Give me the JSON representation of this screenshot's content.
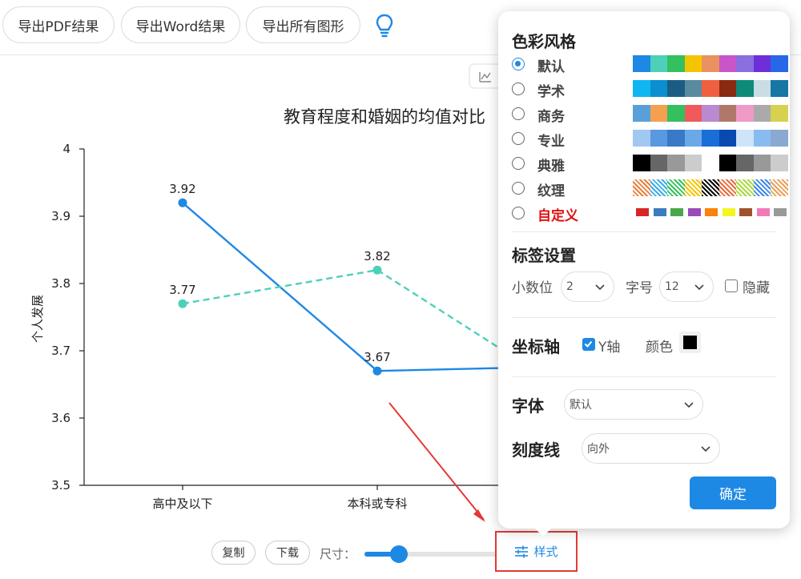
{
  "toolbar": {
    "export_pdf": "导出PDF结果",
    "export_word": "导出Word结果",
    "export_figures": "导出所有图形",
    "bulb_icon": "lightbulb-icon"
  },
  "chart_data": {
    "type": "line",
    "title": "教育程度和婚姻的均值对比",
    "ylabel": "个人发展",
    "xlabel": "",
    "ylim": [
      3.5,
      4
    ],
    "yticks": [
      3.5,
      3.6,
      3.7,
      3.8,
      3.9,
      4
    ],
    "categories": [
      "高中及以下",
      "本科或专科"
    ],
    "series": [
      {
        "values": [
          3.92,
          3.67
        ],
        "color": "#1e88e5",
        "dash": false,
        "extends": true,
        "label_values": [
          "3.92",
          "3.67"
        ]
      },
      {
        "values": [
          3.77,
          3.82
        ],
        "color": "#4dd0b9",
        "dash": true,
        "extends": true,
        "label_values": [
          "3.77",
          "3.82"
        ]
      }
    ],
    "grid": false
  },
  "chart_controls": {
    "copy": "复制",
    "download": "下载",
    "size_label": "尺寸：",
    "size_value": 0.25,
    "style": "样式",
    "style_icon": "sliders-icon"
  },
  "panel": {
    "color_section": "色彩风格",
    "palettes": [
      {
        "label": "默认",
        "selected": true,
        "colors": [
          "#1e88e5",
          "#4dd0b9",
          "#34c05e",
          "#f5c400",
          "#e9925f",
          "#c856c8",
          "#8a6fe0",
          "#6e2fd8",
          "#2668e8"
        ]
      },
      {
        "label": "学术",
        "selected": false,
        "colors": [
          "#10b6f2",
          "#0a8fd0",
          "#1b5d82",
          "#5a8aa0",
          "#f06040",
          "#8a2a10",
          "#0f8a7a",
          "#c9dde4",
          "#1676a4"
        ]
      },
      {
        "label": "商务",
        "selected": false,
        "colors": [
          "#5aa0d8",
          "#f4a050",
          "#34c05e",
          "#f05a5a",
          "#b88ad0",
          "#b07868",
          "#f09ac8",
          "#aaaaaa",
          "#d8d050"
        ]
      },
      {
        "label": "专业",
        "selected": false,
        "colors": [
          "#a0c8f0",
          "#5a98e0",
          "#3a78c8",
          "#6aa8e8",
          "#1a6ed8",
          "#0a4ab0",
          "#d0e4f8",
          "#88bcf0",
          "#8aa8d0"
        ]
      },
      {
        "label": "典雅",
        "selected": false,
        "colors": [
          "#000000",
          "#666666",
          "#999999",
          "#cccccc",
          "#ffffff",
          "#000000",
          "#666666",
          "#999999",
          "#cccccc"
        ]
      },
      {
        "label": "纹理",
        "selected": false,
        "colors": [
          "#e8803a",
          "#3aaee8",
          "#34c05e",
          "#f5c400",
          "#000000",
          "#e86a3a",
          "#a8d83a",
          "#3a88e8",
          "#e8a05a"
        ]
      },
      {
        "label": "自定义",
        "selected": false,
        "custom": true,
        "colors": [
          "#d62728",
          "#3b7cc0",
          "#4aa84a",
          "#9a4ab8",
          "#f7820c",
          "#f5f520",
          "#a0522d",
          "#f07ab8",
          "#999999"
        ]
      }
    ],
    "label_section": "标签设置",
    "decimals_label": "小数位",
    "decimals_value": "2",
    "fontsize_label": "字号",
    "fontsize_value": "12",
    "hide_label": "隐藏",
    "hide_checked": false,
    "axis_section": "坐标轴",
    "y_axis_label": "Y轴",
    "y_axis_checked": true,
    "color_label": "颜色",
    "axis_color": "#000000",
    "font_section": "字体",
    "font_value": "默认",
    "tick_section": "刻度线",
    "tick_value": "向外",
    "confirm": "确定"
  }
}
